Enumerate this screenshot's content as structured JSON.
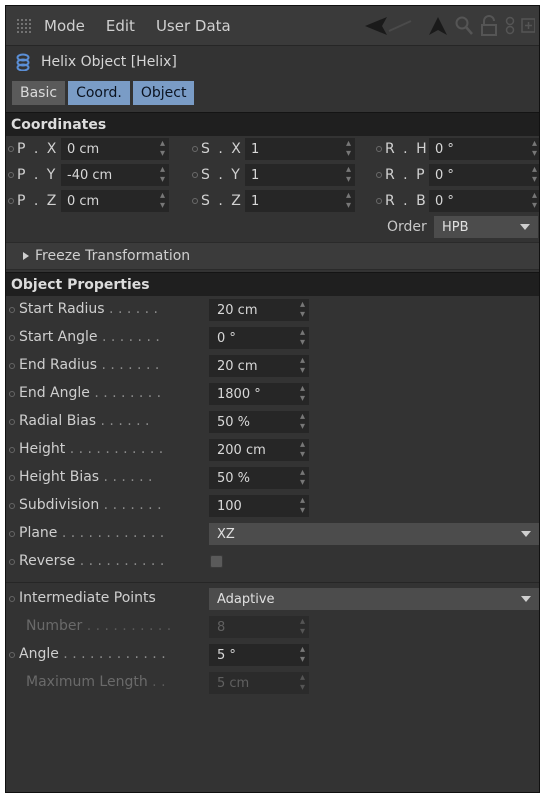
{
  "menubar": {
    "items": [
      "Mode",
      "Edit",
      "User Data"
    ]
  },
  "object": {
    "title": "Helix Object [Helix]"
  },
  "tabs": [
    {
      "label": "Basic"
    },
    {
      "label": "Coord."
    },
    {
      "label": "Object"
    }
  ],
  "coordinates": {
    "section_title": "Coordinates",
    "rows": [
      [
        {
          "label": "P . X",
          "value": "0 cm"
        },
        {
          "label": "S . X",
          "value": "1"
        },
        {
          "label": "R . H",
          "value": "0 °"
        }
      ],
      [
        {
          "label": "P . Y",
          "value": "-40 cm"
        },
        {
          "label": "S . Y",
          "value": "1"
        },
        {
          "label": "R . P",
          "value": "0 °"
        }
      ],
      [
        {
          "label": "P . Z",
          "value": "0 cm"
        },
        {
          "label": "S . Z",
          "value": "1"
        },
        {
          "label": "R . B",
          "value": "0 °"
        }
      ]
    ],
    "order_label": "Order",
    "order_value": "HPB",
    "freeze_label": "Freeze Transformation"
  },
  "object_properties": {
    "section_title": "Object Properties",
    "start_radius": {
      "label": "Start Radius",
      "dots": " . . . . . .",
      "value": "20 cm"
    },
    "start_angle": {
      "label": "Start Angle",
      "dots": " . . . . . . .",
      "value": "0 °"
    },
    "end_radius": {
      "label": "End Radius",
      "dots": " . . . . . . .",
      "value": "20 cm"
    },
    "end_angle": {
      "label": "End Angle",
      "dots": " . . . . . . . .",
      "value": "1800 °"
    },
    "radial_bias": {
      "label": "Radial Bias",
      "dots": " . . . . . .",
      "value": "50 %"
    },
    "height": {
      "label": "Height",
      "dots": " . . . . . . . . . . .",
      "value": "200 cm"
    },
    "height_bias": {
      "label": "Height Bias",
      "dots": " . . . . . .",
      "value": "50 %"
    },
    "subdivision": {
      "label": "Subdivision",
      "dots": " . . . . . . .",
      "value": "100"
    },
    "plane": {
      "label": "Plane",
      "dots": " . . . . . . . . . . . .",
      "value": "XZ"
    },
    "reverse": {
      "label": "Reverse",
      "dots": " . . . . . . . . . .",
      "checked": false
    },
    "intermediate_points": {
      "label": "Intermediate Points",
      "value": "Adaptive"
    },
    "number": {
      "label": "Number",
      "dots": " . . . . . . . . . .",
      "value": "8"
    },
    "angle": {
      "label": "Angle",
      "dots": " . . . . . . . . . . . .",
      "value": "5 °"
    },
    "max_length": {
      "label": "Maximum Length",
      "dots": " . .",
      "value": "5 cm"
    }
  },
  "colors": {
    "panel_bg": "#333333",
    "section_bg": "#1f1f1f",
    "field_bg": "#262626",
    "active_tab": "#7a9cc6"
  },
  "icons": [
    "grip-icon",
    "back-arrow-icon",
    "cursor-arrow-icon",
    "search-icon",
    "lock-icon",
    "hierarchy-icon",
    "new-panel-icon",
    "helix-icon"
  ]
}
